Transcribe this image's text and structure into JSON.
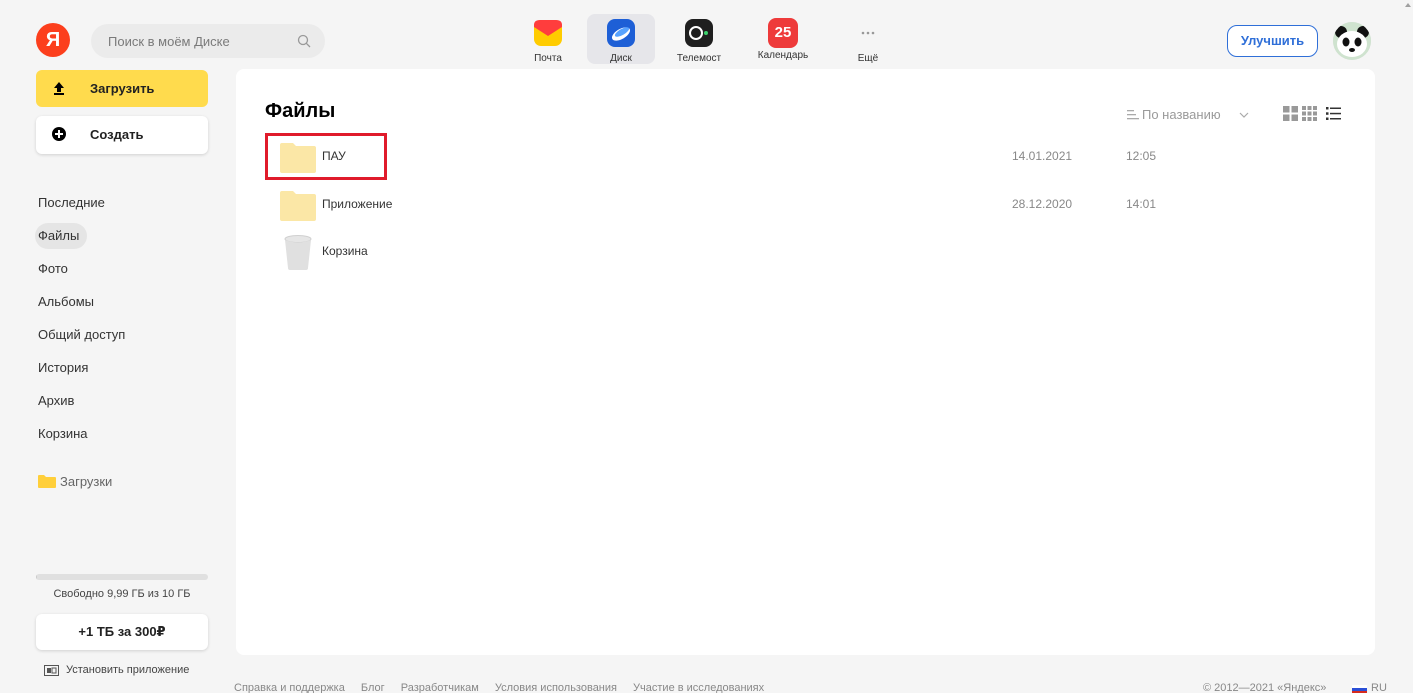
{
  "header": {
    "logo": "Я",
    "search": {
      "placeholder": "Поиск в моём Диске"
    },
    "services": [
      {
        "label": "Почта",
        "icon": "mail-icon",
        "color": "#ff3d3d"
      },
      {
        "label": "Диск",
        "icon": "disk-icon",
        "color": "#2a6be6",
        "active": true
      },
      {
        "label": "Телемост",
        "icon": "telemost-icon",
        "color": "#1f1f1f"
      },
      {
        "label": "Календарь",
        "icon": "calendar-icon",
        "color": "#ee3a3a",
        "badge": "25"
      },
      {
        "label": "Ещё",
        "icon": "more-icon"
      }
    ],
    "upgrade_label": "Улучшить"
  },
  "sidebar": {
    "upload_label": "Загрузить",
    "create_label": "Создать",
    "nav": [
      {
        "label": "Последние"
      },
      {
        "label": "Файлы",
        "active": true
      },
      {
        "label": "Фото"
      },
      {
        "label": "Альбомы"
      },
      {
        "label": "Общий доступ"
      },
      {
        "label": "История"
      },
      {
        "label": "Архив"
      },
      {
        "label": "Корзина"
      }
    ],
    "folder_link": "Загрузки",
    "quota_text": "Свободно 9,99 ГБ из 10 ГБ",
    "quota_used_fraction": 0.001,
    "buy_label": "+1 ТБ за 300₽",
    "install_label": "Установить приложение"
  },
  "main": {
    "title": "Файлы",
    "sort_label": "По названию",
    "files": [
      {
        "name": "ПАУ",
        "type": "folder",
        "date": "14.01.2021",
        "time": "12:05",
        "highlighted": true
      },
      {
        "name": "Приложение",
        "type": "folder",
        "date": "28.12.2020",
        "time": "14:01"
      },
      {
        "name": "Корзина",
        "type": "trash",
        "date": "",
        "time": ""
      }
    ]
  },
  "footer": {
    "links": [
      "Справка и поддержка",
      "Блог",
      "Разработчикам",
      "Условия использования",
      "Участие в исследованиях"
    ],
    "copyright": "© 2012—2021 «Яндекс»",
    "lang": "RU"
  },
  "colors": {
    "accent_yellow": "#ffdb4d",
    "link_blue": "#2f6fd8",
    "highlight_red": "#e01b2b",
    "folder": "#fbe7a6"
  }
}
